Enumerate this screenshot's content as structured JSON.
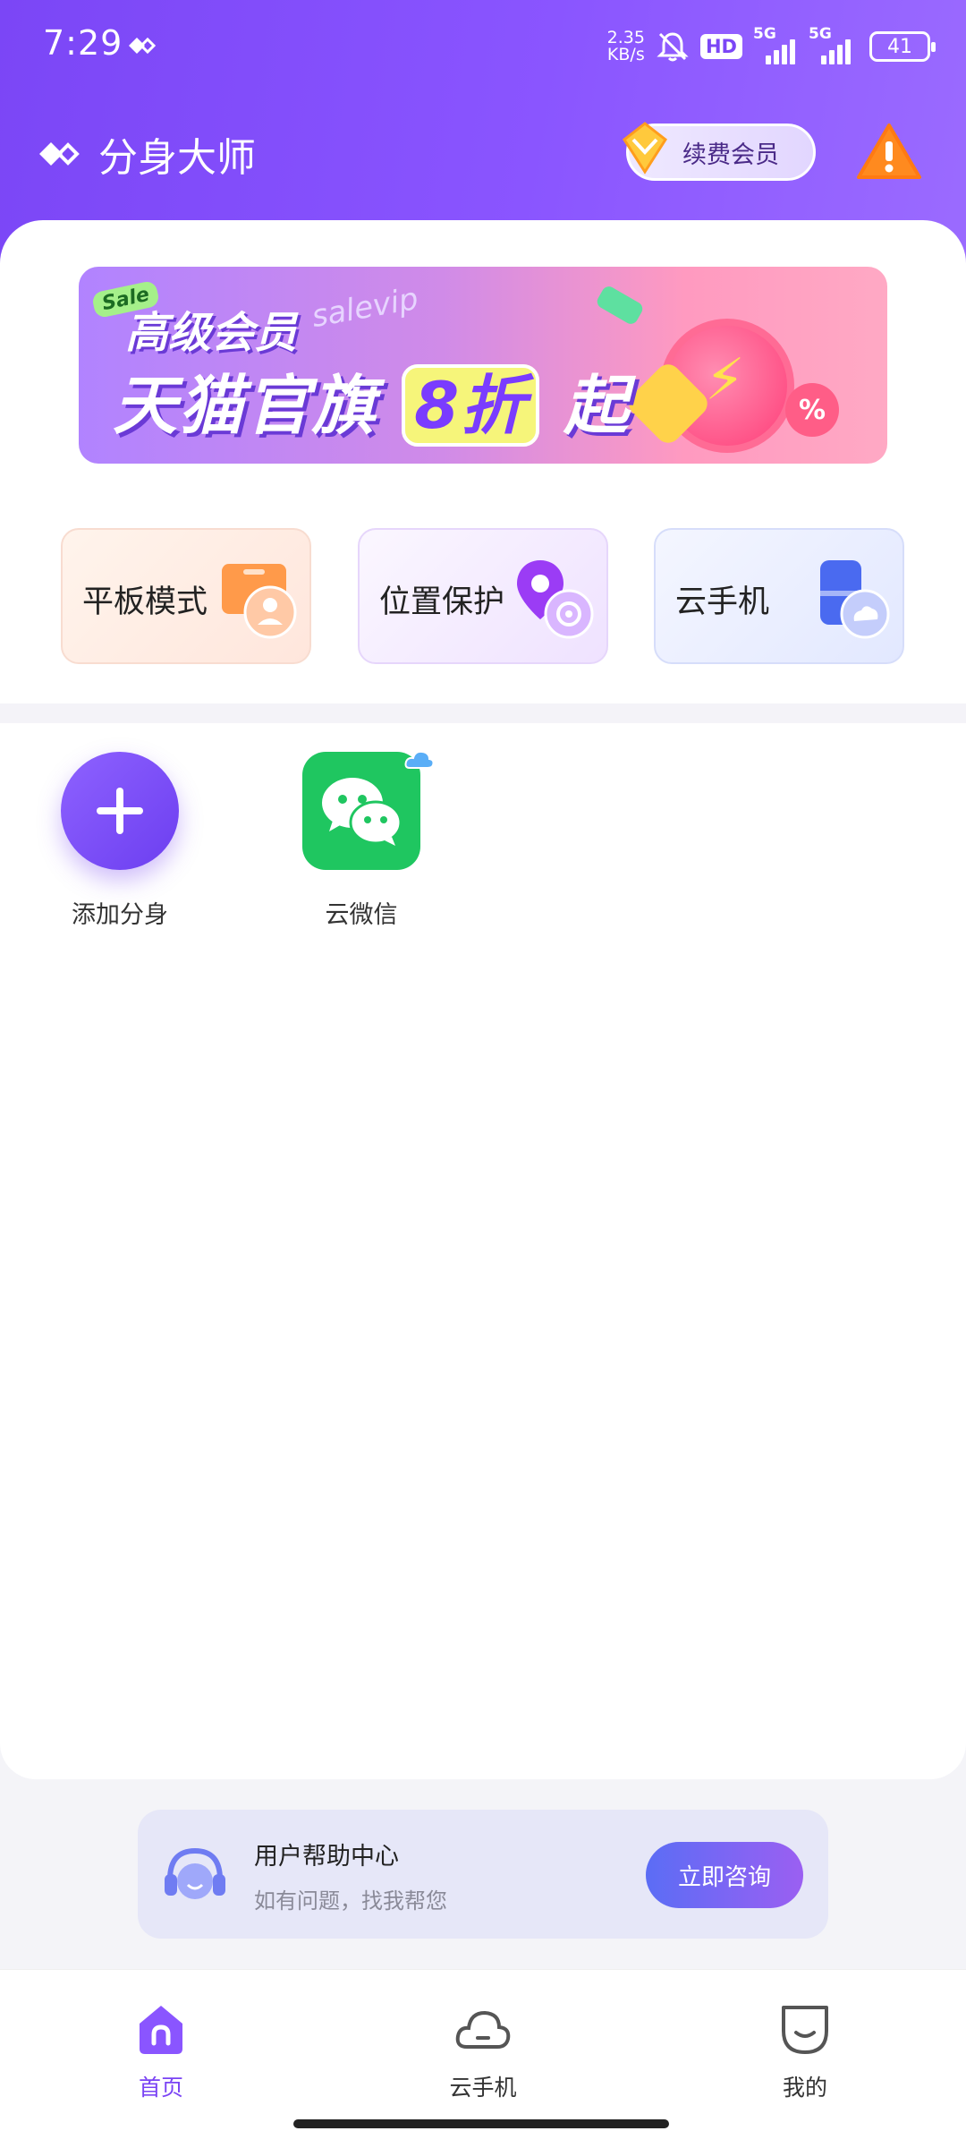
{
  "status_bar": {
    "time": "7:29",
    "net_speed_value": "2.35",
    "net_speed_unit": "KB/s",
    "hd_label": "HD",
    "signal1_label": "5G",
    "signal2_label": "5G",
    "battery": "41"
  },
  "header": {
    "app_title": "分身大师",
    "vip_button": "续费会员"
  },
  "banner": {
    "sale_tag": "Sale",
    "line1": "高级会员",
    "script_text": "salevip",
    "line2_prefix": "天猫官旗",
    "line2_highlight": "8折",
    "line2_suffix": "起",
    "percent_badge": "%"
  },
  "features": [
    {
      "label": "平板模式"
    },
    {
      "label": "位置保护"
    },
    {
      "label": "云手机"
    }
  ],
  "apps": [
    {
      "label": "添加分身"
    },
    {
      "label": "云微信"
    }
  ],
  "help": {
    "title": "用户帮助中心",
    "subtitle": "如有问题，找我帮您",
    "button": "立即咨询"
  },
  "bottom_nav": {
    "items": [
      {
        "label": "首页"
      },
      {
        "label": "云手机"
      },
      {
        "label": "我的"
      }
    ],
    "active_index": 0
  },
  "colors": {
    "brand_purple": "#7b46f6",
    "wechat_green": "#1fc660"
  }
}
